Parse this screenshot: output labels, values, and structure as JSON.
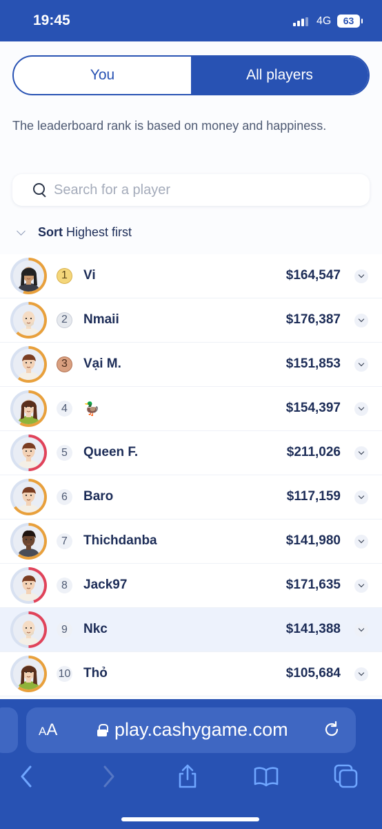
{
  "status": {
    "time": "19:45",
    "network": "4G",
    "battery": "63"
  },
  "tabs": [
    {
      "label": "You",
      "active": false
    },
    {
      "label": "All players",
      "active": true
    }
  ],
  "description": "The leaderboard rank is based on money and happiness.",
  "search": {
    "placeholder": "Search for a player",
    "value": ""
  },
  "sort": {
    "label": "Sort",
    "value": "Highest first"
  },
  "colors": {
    "brand": "#2852b3",
    "ring_orange": "#e8a03c",
    "ring_red": "#e0435a",
    "ring_track": "#d8e1f1"
  },
  "players": [
    {
      "rank": "1",
      "medal": "gold",
      "name": "Vi",
      "money": "$164,547",
      "avatar": "woman-dark-hair-dark-top",
      "ring": "orange",
      "ring_level": 0.55
    },
    {
      "rank": "2",
      "medal": "silver",
      "name": "Nmaii",
      "money": "$176,387",
      "avatar": "bald-man-beard",
      "ring": "orange",
      "ring_level": 0.62
    },
    {
      "rank": "3",
      "medal": "bronze",
      "name": "Vại M.",
      "money": "$151,853",
      "avatar": "man-brown-hair",
      "ring": "orange",
      "ring_level": 0.6
    },
    {
      "rank": "4",
      "medal": "",
      "name": "🦆",
      "money": "$154,397",
      "avatar": "woman-green-top",
      "ring": "orange",
      "ring_level": 0.58
    },
    {
      "rank": "5",
      "medal": "",
      "name": "Queen F.",
      "money": "$211,026",
      "avatar": "man-brown-hair",
      "ring": "red",
      "ring_level": 0.5
    },
    {
      "rank": "6",
      "medal": "",
      "name": "Baro",
      "money": "$117,159",
      "avatar": "man-brown-hair",
      "ring": "orange",
      "ring_level": 0.65
    },
    {
      "rank": "7",
      "medal": "",
      "name": "Thichdanba",
      "money": "$141,980",
      "avatar": "woman-dark-skin",
      "ring": "orange",
      "ring_level": 0.6
    },
    {
      "rank": "8",
      "medal": "",
      "name": "Jack97",
      "money": "$171,635",
      "avatar": "man-brown-hair",
      "ring": "red",
      "ring_level": 0.45
    },
    {
      "rank": "9",
      "medal": "",
      "name": "Nkc",
      "money": "$141,388",
      "avatar": "bald-man-beard",
      "ring": "red",
      "ring_level": 0.5,
      "highlighted": true
    },
    {
      "rank": "10",
      "medal": "",
      "name": "Thỏ",
      "money": "$105,684",
      "avatar": "woman-green-top",
      "ring": "orange",
      "ring_level": 0.6
    }
  ],
  "browser": {
    "text_size_label": "AA",
    "url": "play.cashygame.com",
    "toolbar": [
      "back-icon",
      "forward-icon",
      "share-icon",
      "bookmarks-icon",
      "tabs-icon"
    ]
  }
}
